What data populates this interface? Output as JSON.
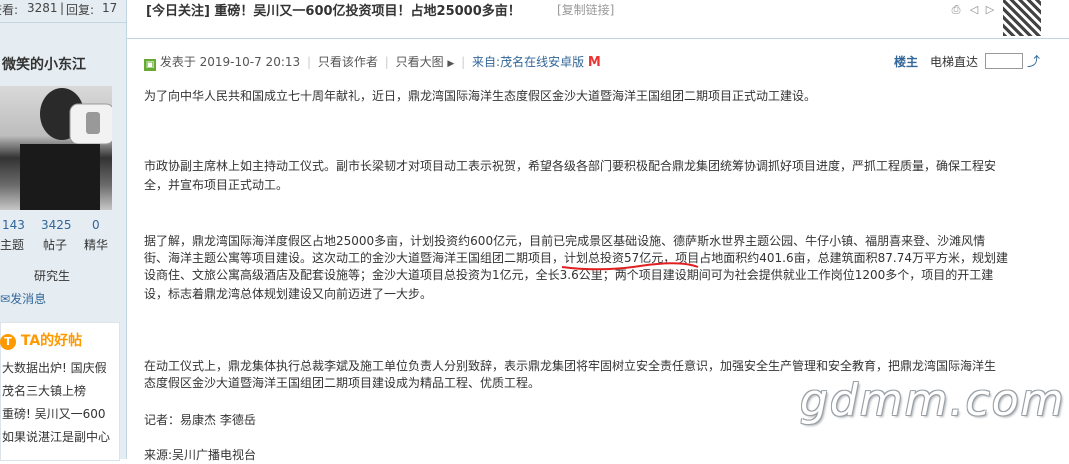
{
  "stats": {
    "views_label": "查看:",
    "views": "3281",
    "sep": "|",
    "replies_label": "回复:",
    "replies": "17"
  },
  "thread": {
    "title": "[今日关注] 重磅！吴川又一600亿投资项目！占地25000多亩！",
    "copy_link": "[复制链接]"
  },
  "author": {
    "name": "微笑的小东江",
    "stats": [
      {
        "value": "143",
        "label": "主题"
      },
      {
        "value": "3425",
        "label": "帖子"
      },
      {
        "value": "0",
        "label": "精华"
      }
    ],
    "rank": "研究生",
    "send_message": "发消息"
  },
  "ta_posts": {
    "title": "TA的好帖",
    "items": [
      "大数据出炉! 国庆假",
      "茂名三大镇上榜",
      "重磅! 吴川又一600",
      "如果说湛江是副中心"
    ]
  },
  "post": {
    "posted": "发表于 2019-10-7 20:13",
    "only_author": "只看该作者",
    "only_images": "只看大图",
    "from": "来自:茂名在线安卓版",
    "louzhu": "楼主",
    "elevator": "电梯直达",
    "paragraphs": [
      "为了向中华人民共和国成立七十周年献礼，近日，鼎龙湾国际海洋生态度假区金沙大道暨海洋王国组团二期项目正式动工建设。",
      "市政协副主席林上如主持动工仪式。副市长梁韧才对项目动工表示祝贺，希望各级各部门要积极配合鼎龙集团统筹协调抓好项目进度，严抓工程质量，确保工程安",
      "全，并宣布项目正式动工。",
      "据了解，鼎龙湾国际海洋度假区占地25000多亩，计划投资约600亿元，目前已完成景区基础设施、德萨斯水世界主题公园、牛仔小镇、福朋喜来登、沙滩风情",
      "街、海洋主题公寓等项目建设。这次动工的金沙大道暨海洋王国组团二期项目，计划总投资57亿元，项目占地面积约401.6亩，总建筑面积87.74万平方米，规划建",
      "设商住、文旅公寓高级酒店及配套设施等；金沙大道项目总投资为1亿元，全长3.6公里；两个项目建设期间可为社会提供就业工作岗位1200多个，项目的开工建",
      "设，标志着鼎龙湾总体规划建设又向前迈进了一大步。",
      "在动工仪式上，鼎龙集体执行总裁李斌及施工单位负责人分别致辞，表示鼎龙集团将牢固树立安全责任意识，加强安全生产管理和安全教育，把鼎龙湾国际海洋生",
      "态度假区金沙大道暨海洋王国组团二期项目建设成为精品工程、优质工程。",
      "记者：易康杰 李德岳",
      "来源:吴川广播电视台"
    ]
  },
  "watermark": "gdmm.com",
  "colors": {
    "accent": "#369",
    "views_red": "#f00",
    "ta_orange": "#f90"
  }
}
